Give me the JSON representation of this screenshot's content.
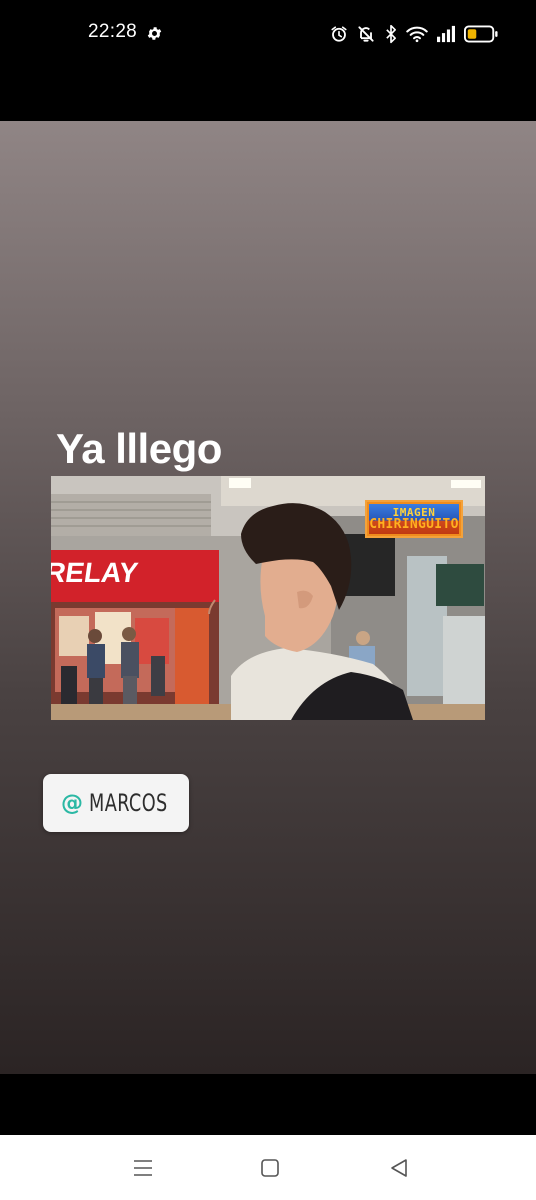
{
  "status_bar": {
    "time": "22:28",
    "icons": [
      "gear-icon",
      "alarm-icon",
      "mute-icon",
      "bluetooth-icon",
      "wifi-icon",
      "signal-icon",
      "battery-icon"
    ],
    "battery_color": "#f0b400"
  },
  "story": {
    "caption": "Ya lllego",
    "video": {
      "store_sign": "RELAY",
      "watermark_top": "IMAGEN",
      "watermark_bottom": "CHIRINGUITO"
    },
    "mention": {
      "at": "@",
      "username": "MARCOS"
    },
    "colors": {
      "gradient_top": "#908585",
      "gradient_bottom": "#2b2424",
      "mention_accent": "#2bb8a4"
    }
  },
  "nav_bar": {
    "buttons": [
      "menu-icon",
      "home-icon",
      "back-icon"
    ]
  }
}
